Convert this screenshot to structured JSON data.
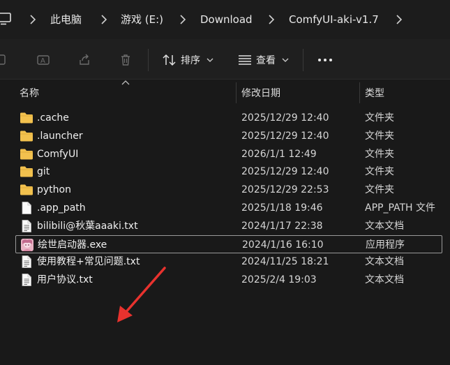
{
  "breadcrumb": {
    "items": [
      "此电脑",
      "游戏 (E:)",
      "Download",
      "ComfyUI-aki-v1.7"
    ]
  },
  "toolbar": {
    "sort_label": "排序",
    "view_label": "查看"
  },
  "columns": {
    "name": "名称",
    "modified": "修改日期",
    "type": "类型"
  },
  "files": [
    {
      "name": ".cache",
      "modified": "2025/12/29 12:40",
      "type": "文件夹",
      "icon": "folder-icon"
    },
    {
      "name": ".launcher",
      "modified": "2025/12/29 12:40",
      "type": "文件夹",
      "icon": "folder-icon"
    },
    {
      "name": "ComfyUI",
      "modified": "2026/1/1 12:49",
      "type": "文件夹",
      "icon": "folder-icon"
    },
    {
      "name": "git",
      "modified": "2025/12/29 12:40",
      "type": "文件夹",
      "icon": "folder-icon"
    },
    {
      "name": "python",
      "modified": "2025/12/29 22:53",
      "type": "文件夹",
      "icon": "folder-icon"
    },
    {
      "name": ".app_path",
      "modified": "2025/1/18 19:46",
      "type": "APP_PATH 文件",
      "icon": "blank-file-icon"
    },
    {
      "name": "bilibili@秋葉aaaki.txt",
      "modified": "2024/1/17 22:38",
      "type": "文本文档",
      "icon": "text-file-icon"
    },
    {
      "name": "绘世启动器.exe",
      "modified": "2024/1/16 16:10",
      "type": "应用程序",
      "icon": "app-icon",
      "selected": true
    },
    {
      "name": "使用教程+常见问题.txt",
      "modified": "2024/11/25 18:21",
      "type": "文本文档",
      "icon": "text-file-icon"
    },
    {
      "name": "用户协议.txt",
      "modified": "2025/2/4 19:03",
      "type": "文本文档",
      "icon": "text-file-icon"
    }
  ],
  "colors": {
    "background": "#191919",
    "folder": "#f2c14e",
    "annotation_arrow": "#e8322e",
    "selection_border": "#9a9a9a"
  }
}
